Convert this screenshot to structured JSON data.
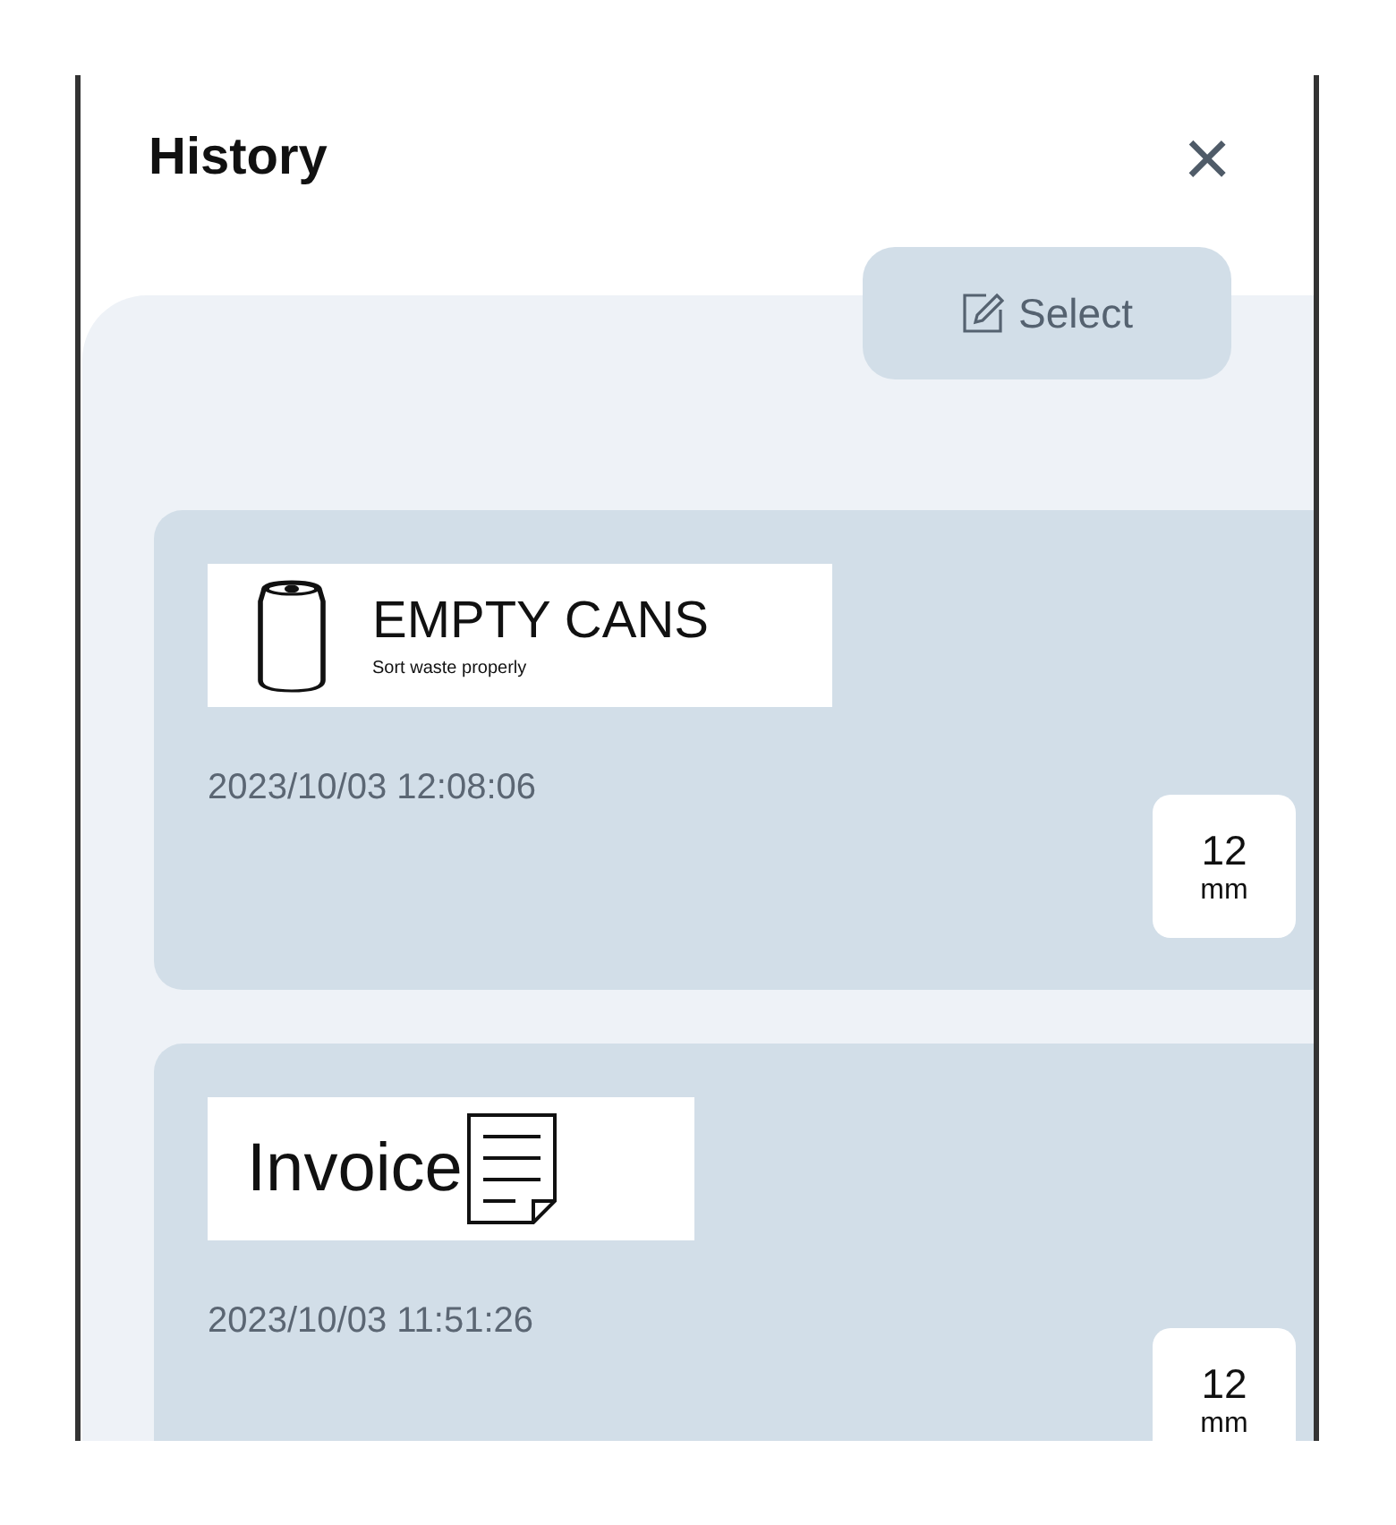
{
  "header": {
    "title": "History",
    "close_icon": "×"
  },
  "select_button": {
    "label": "Select"
  },
  "entries": [
    {
      "label": {
        "kind": "can",
        "title": "EMPTY CANS",
        "subtitle": "Sort waste properly"
      },
      "timestamp": "2023/10/03 12:08:06",
      "size": {
        "value": "12",
        "unit": "mm"
      }
    },
    {
      "label": {
        "kind": "invoice",
        "title": "Invoice"
      },
      "timestamp": "2023/10/03 11:51:26",
      "size": {
        "value": "12",
        "unit": "mm"
      }
    }
  ]
}
